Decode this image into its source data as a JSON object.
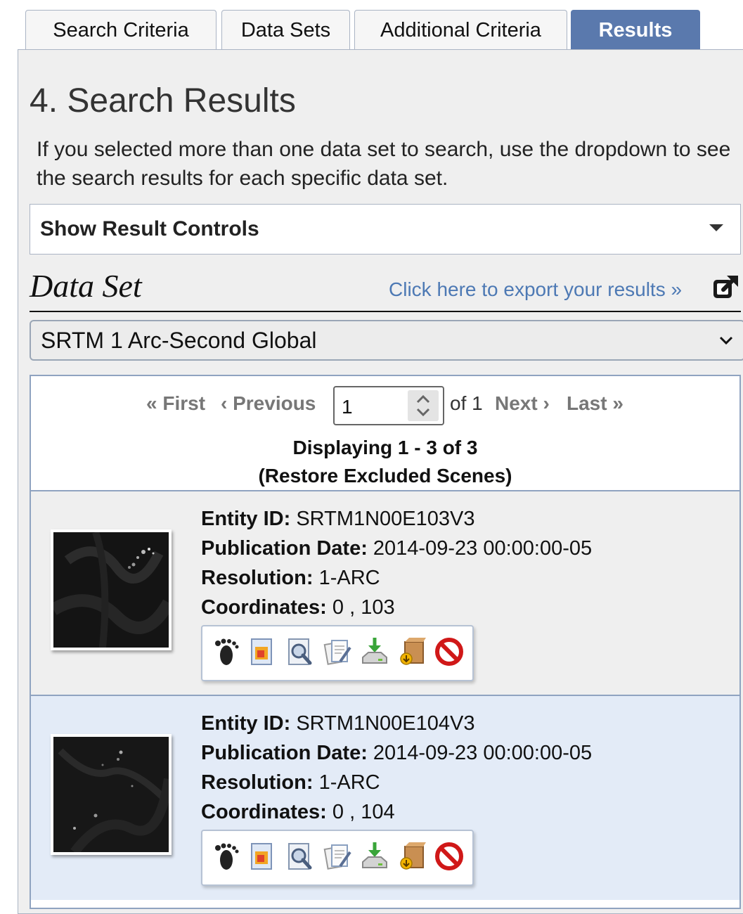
{
  "tabs": [
    {
      "label": "Search Criteria",
      "active": false
    },
    {
      "label": "Data Sets",
      "active": false
    },
    {
      "label": "Additional Criteria",
      "active": false
    },
    {
      "label": "Results",
      "active": true
    }
  ],
  "heading": "4. Search Results",
  "intro": "If you selected more than one data set to search, use the dropdown to see the search results for each specific data set.",
  "result_controls_label": "Show Result Controls",
  "dataset_heading": "Data Set",
  "export_link": "Click here to export your results »",
  "dataset_select": "SRTM 1 Arc-Second Global",
  "pager": {
    "first": "« First",
    "previous": "‹ Previous",
    "page_value": "1",
    "of_label": "of 1",
    "next": "Next ›",
    "last": "Last »",
    "displaying": "Displaying 1 - 3 of 3",
    "restore": "(Restore Excluded Scenes)"
  },
  "labels": {
    "entity_id": "Entity ID:",
    "publication_date": "Publication Date:",
    "resolution": "Resolution:",
    "coordinates": "Coordinates:"
  },
  "results": [
    {
      "entity_id": "SRTM1N00E103V3",
      "publication_date": "2014-09-23 00:00:00-05",
      "resolution": "1-ARC",
      "coordinates": "0 , 103"
    },
    {
      "entity_id": "SRTM1N00E104V3",
      "publication_date": "2014-09-23 00:00:00-05",
      "resolution": "1-ARC",
      "coordinates": "0 , 104"
    }
  ],
  "action_icons": [
    "footprint-icon",
    "overlay-icon",
    "metadata-icon",
    "compare-icon",
    "download-icon",
    "order-icon",
    "exclude-icon"
  ],
  "colors": {
    "active_tab": "#5a79ad",
    "link": "#4d79b4",
    "row_highlight": "#e3ebf7"
  }
}
